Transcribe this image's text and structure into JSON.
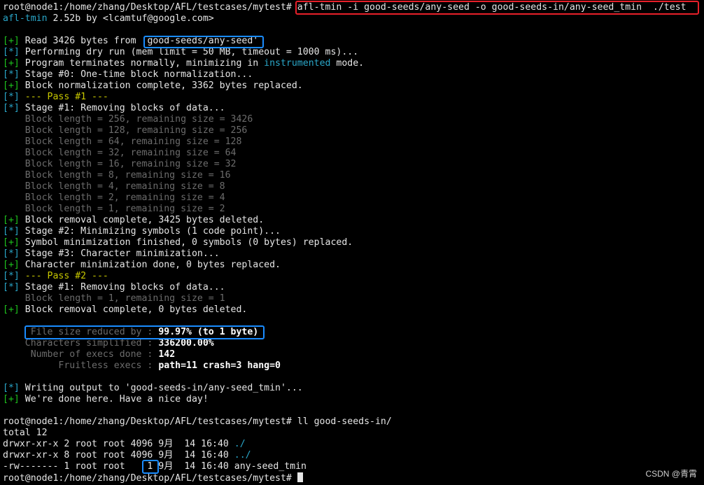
{
  "watermark": "CSDN @青霄",
  "lines": [
    [
      {
        "t": "root@node1:/home/zhang/Desktop/AFL/testcases/mytest# ",
        "c": "w"
      },
      {
        "t": "afl-tmin -i good-seeds/any-seed -o good-seeds-in/any-seed_tmin  ./test",
        "c": "w"
      }
    ],
    [
      {
        "t": "afl-tmin",
        "c": "c"
      },
      {
        "t": " 2.52b by <lcamtuf@google.com>",
        "c": "w"
      }
    ],
    [
      {
        "t": "",
        "c": "w"
      }
    ],
    [
      {
        "t": "[+]",
        "c": "g"
      },
      {
        "t": " Read 3426 bytes from 'good-seeds/any-seed'",
        "c": "w"
      }
    ],
    [
      {
        "t": "[*]",
        "c": "c"
      },
      {
        "t": " Performing dry run (mem limit = 50 MB, timeout = 1000 ms)...",
        "c": "w"
      }
    ],
    [
      {
        "t": "[+]",
        "c": "g"
      },
      {
        "t": " Program terminates normally, minimizing in ",
        "c": "w"
      },
      {
        "t": "instrumented",
        "c": "c"
      },
      {
        "t": " mode.",
        "c": "w"
      }
    ],
    [
      {
        "t": "[*]",
        "c": "c"
      },
      {
        "t": " Stage #0: One-time block normalization...",
        "c": "w"
      }
    ],
    [
      {
        "t": "[+]",
        "c": "g"
      },
      {
        "t": " Block normalization complete, 3362 bytes replaced.",
        "c": "w"
      }
    ],
    [
      {
        "t": "[*]",
        "c": "c"
      },
      {
        "t": " --- Pass #1 ---",
        "c": "y"
      }
    ],
    [
      {
        "t": "[*]",
        "c": "c"
      },
      {
        "t": " Stage #1: Removing blocks of data...",
        "c": "w"
      }
    ],
    [
      {
        "t": "    Block length = 256, remaining size = 3426",
        "c": "d"
      }
    ],
    [
      {
        "t": "    Block length = 128, remaining size = 256",
        "c": "d"
      }
    ],
    [
      {
        "t": "    Block length = 64, remaining size = 128",
        "c": "d"
      }
    ],
    [
      {
        "t": "    Block length = 32, remaining size = 64",
        "c": "d"
      }
    ],
    [
      {
        "t": "    Block length = 16, remaining size = 32",
        "c": "d"
      }
    ],
    [
      {
        "t": "    Block length = 8, remaining size = 16",
        "c": "d"
      }
    ],
    [
      {
        "t": "    Block length = 4, remaining size = 8",
        "c": "d"
      }
    ],
    [
      {
        "t": "    Block length = 2, remaining size = 4",
        "c": "d"
      }
    ],
    [
      {
        "t": "    Block length = 1, remaining size = 2",
        "c": "d"
      }
    ],
    [
      {
        "t": "[+]",
        "c": "g"
      },
      {
        "t": " Block removal complete, 3425 bytes deleted.",
        "c": "w"
      }
    ],
    [
      {
        "t": "[*]",
        "c": "c"
      },
      {
        "t": " Stage #2: Minimizing symbols (1 code point)...",
        "c": "w"
      }
    ],
    [
      {
        "t": "[+]",
        "c": "g"
      },
      {
        "t": " Symbol minimization finished, 0 symbols (0 bytes) replaced.",
        "c": "w"
      }
    ],
    [
      {
        "t": "[*]",
        "c": "c"
      },
      {
        "t": " Stage #3: Character minimization...",
        "c": "w"
      }
    ],
    [
      {
        "t": "[+]",
        "c": "g"
      },
      {
        "t": " Character minimization done, 0 bytes replaced.",
        "c": "w"
      }
    ],
    [
      {
        "t": "[*]",
        "c": "c"
      },
      {
        "t": " --- Pass #2 ---",
        "c": "y"
      }
    ],
    [
      {
        "t": "[*]",
        "c": "c"
      },
      {
        "t": " Stage #1: Removing blocks of data...",
        "c": "w"
      }
    ],
    [
      {
        "t": "    Block length = 1, remaining size = 1",
        "c": "d"
      }
    ],
    [
      {
        "t": "[+]",
        "c": "g"
      },
      {
        "t": " Block removal complete, 0 bytes deleted.",
        "c": "w"
      }
    ],
    [
      {
        "t": "",
        "c": "w"
      }
    ],
    [
      {
        "t": "     File size reduced by : ",
        "c": "d"
      },
      {
        "t": "99.97% (to 1 byte)",
        "c": "wb"
      }
    ],
    [
      {
        "t": "    Characters simplified : ",
        "c": "d"
      },
      {
        "t": "336200.00%",
        "c": "wb"
      }
    ],
    [
      {
        "t": "     Number of execs done : ",
        "c": "d"
      },
      {
        "t": "142",
        "c": "wb"
      }
    ],
    [
      {
        "t": "          Fruitless execs : ",
        "c": "d"
      },
      {
        "t": "path=11 crash=3 hang=0",
        "c": "wb"
      }
    ],
    [
      {
        "t": "",
        "c": "w"
      }
    ],
    [
      {
        "t": "[*]",
        "c": "c"
      },
      {
        "t": " Writing output to 'good-seeds-in/any-seed_tmin'...",
        "c": "w"
      }
    ],
    [
      {
        "t": "[+]",
        "c": "g"
      },
      {
        "t": " We're done here. Have a nice day!",
        "c": "w"
      }
    ],
    [
      {
        "t": "",
        "c": "w"
      }
    ],
    [
      {
        "t": "root@node1:/home/zhang/Desktop/AFL/testcases/mytest# ll good-seeds-in/",
        "c": "w"
      }
    ],
    [
      {
        "t": "total 12",
        "c": "w"
      }
    ],
    [
      {
        "t": "drwxr-xr-x 2 root root 4096 9月  14 16:40 ",
        "c": "w"
      },
      {
        "t": "./",
        "c": "c"
      }
    ],
    [
      {
        "t": "drwxr-xr-x 8 root root 4096 9月  14 16:40 ",
        "c": "w"
      },
      {
        "t": "../",
        "c": "c"
      }
    ],
    [
      {
        "t": "-rw------- 1 root root    1 9月  14 16:40 any-seed_tmin",
        "c": "w"
      }
    ],
    [
      {
        "t": "root@node1:/home/zhang/Desktop/AFL/testcases/mytest# ",
        "c": "w"
      }
    ]
  ]
}
